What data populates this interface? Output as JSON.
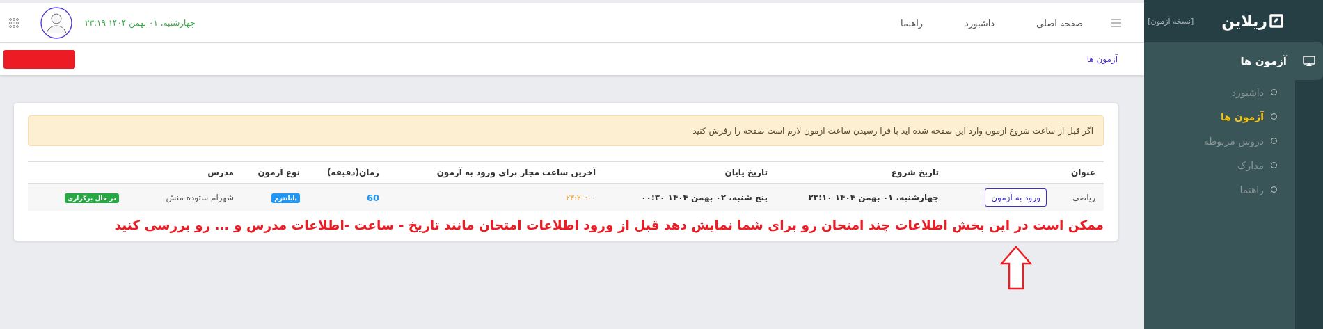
{
  "sidebar": {
    "logo": "ریلاین",
    "version_label": "[نسخه آزمون]",
    "section": {
      "title": "آزمون ها"
    },
    "items": [
      {
        "label": "داشبورد",
        "selected": false
      },
      {
        "label": "آزمون ها",
        "selected": true
      },
      {
        "label": "دروس مربوطه",
        "selected": false
      },
      {
        "label": "مدارک",
        "selected": false
      },
      {
        "label": "راهنما",
        "selected": false
      }
    ]
  },
  "header": {
    "nav": [
      "صفحه اصلی",
      "داشبورد",
      "راهنما"
    ],
    "datetime": "چهارشنبه، ۰۱ بهمن ۱۴۰۴ ۲۳:۱۹"
  },
  "breadcrumb": "آزمون ها",
  "alert": "اگر قبل از ساعت شروع ازمون وارد این صفحه شده اید با فرا رسیدن ساعت ازمون لازم است صفحه را رفرش کنید",
  "table": {
    "columns": [
      "عنوان",
      "تاریخ شروع",
      "تاریخ پایان",
      "آخرین ساعت مجاز برای ورود به آزمون",
      "زمان(دقیقه)",
      "نوع آزمون",
      "مدرس"
    ],
    "rows": [
      {
        "title": "ریاضی",
        "action": "ورود به آزمون",
        "start": "چهارشنبه، ۰۱ بهمن ۱۴۰۴ ۲۳:۱۰",
        "end": "پنج شنبه، ۰۲ بهمن ۱۴۰۴ ۰۰:۳۰",
        "last_entry": "۲۳:۲۰:۰۰",
        "duration": "60",
        "exam_type": "پایانترم",
        "teacher": "شهرام ستوده منش",
        "status": "در حال برگزاری"
      }
    ]
  },
  "annotation": {
    "text": "ممکن است در این بخش اطلاعات چند امتحان رو برای شما نمایش دهد قبل از ورود اطلاعات امتحان مانند تاریخ - ساعت -اطلاعات مدرس و ... رو بررسی کنید"
  }
}
